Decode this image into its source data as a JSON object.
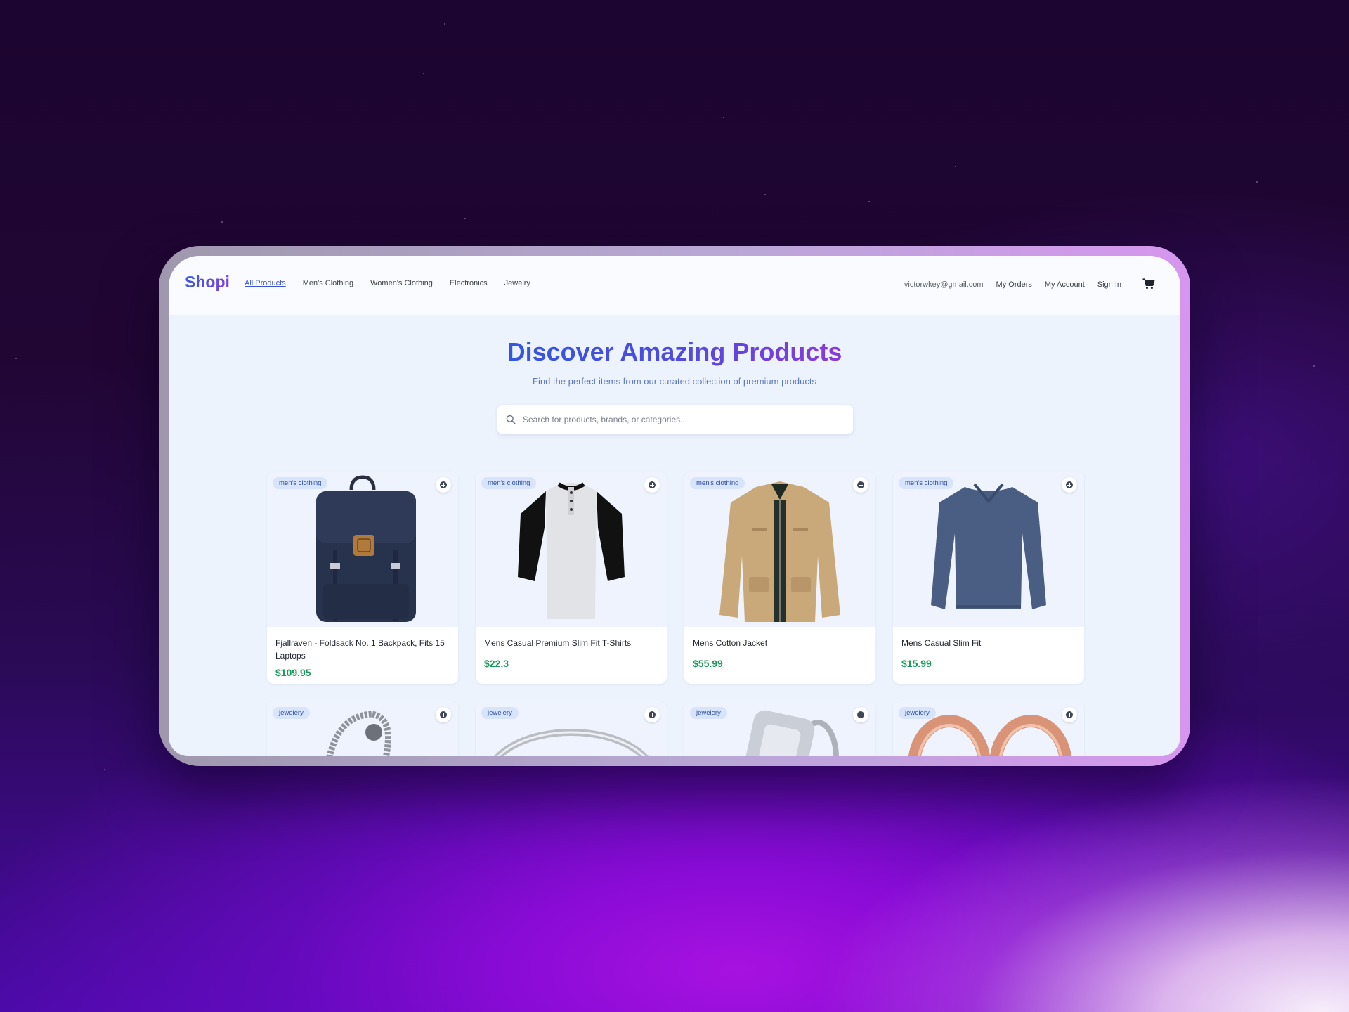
{
  "brand": {
    "name": "Shopi"
  },
  "nav": {
    "items": [
      {
        "label": "All Products",
        "active": true
      },
      {
        "label": "Men's Clothing",
        "active": false
      },
      {
        "label": "Women's Clothing",
        "active": false
      },
      {
        "label": "Electronics",
        "active": false
      },
      {
        "label": "Jewelry",
        "active": false
      }
    ]
  },
  "account": {
    "email": "victorwkey@gmail.com",
    "orders_label": "My Orders",
    "account_label": "My Account",
    "signin_label": "Sign In",
    "cart_icon": "cart-icon"
  },
  "hero": {
    "title": "Discover Amazing Products",
    "subtitle": "Find the perfect items from our curated collection of premium products"
  },
  "search": {
    "placeholder": "Search for products, brands, or categories...",
    "value": "",
    "icon": "search-icon"
  },
  "colors": {
    "accent": "#3a55d6",
    "price": "#1a9a5a",
    "badge_bg": "#d7e4fb",
    "badge_text": "#2e4fa8"
  },
  "products": [
    {
      "category": "men's clothing",
      "name": "Fjallraven - Foldsack No. 1 Backpack, Fits 15 Laptops",
      "price": "$109.95",
      "image": "backpack"
    },
    {
      "category": "men's clothing",
      "name": "Mens Casual Premium Slim Fit T-Shirts",
      "price": "$22.3",
      "image": "raglan-tshirt"
    },
    {
      "category": "men's clothing",
      "name": "Mens Cotton Jacket",
      "price": "$55.99",
      "image": "khaki-jacket"
    },
    {
      "category": "men's clothing",
      "name": "Mens Casual Slim Fit",
      "price": "$15.99",
      "image": "blue-longsleeve"
    },
    {
      "category": "jewelery",
      "name": "",
      "price": "",
      "image": "chain-bracelet"
    },
    {
      "category": "jewelery",
      "name": "",
      "price": "",
      "image": "silver-ring"
    },
    {
      "category": "jewelery",
      "name": "",
      "price": "",
      "image": "diamond-ring"
    },
    {
      "category": "jewelery",
      "name": "",
      "price": "",
      "image": "rose-gold-rings"
    }
  ]
}
